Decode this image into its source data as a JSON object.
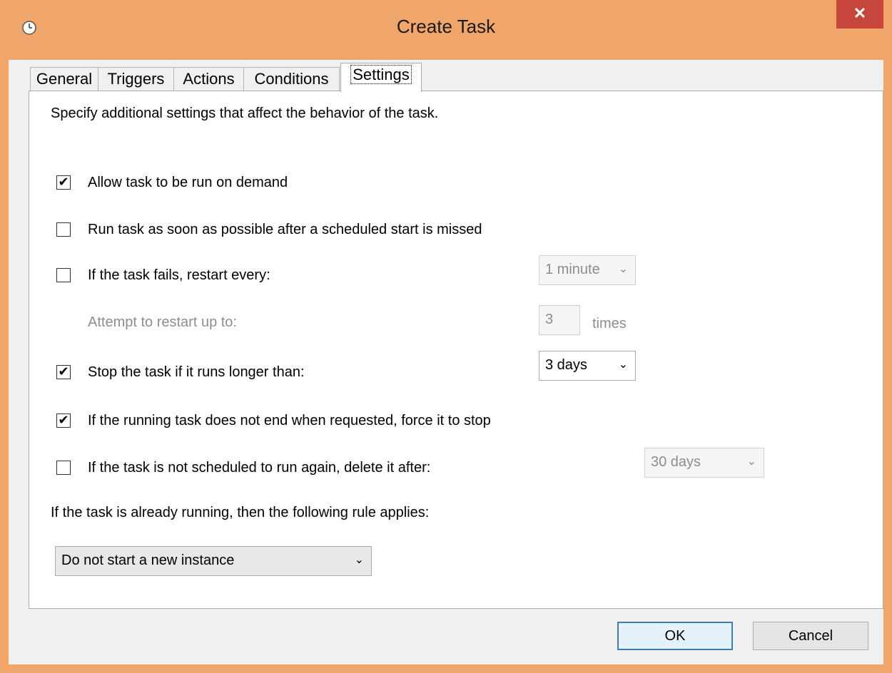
{
  "window": {
    "title": "Create Task",
    "close_glyph": "✕"
  },
  "tabs": [
    {
      "label": "General"
    },
    {
      "label": "Triggers"
    },
    {
      "label": "Actions"
    },
    {
      "label": "Conditions"
    },
    {
      "label": "Settings",
      "active": true
    }
  ],
  "settings": {
    "description": "Specify additional settings that affect the behavior of the task.",
    "allow_on_demand": {
      "label": "Allow task to be run on demand",
      "checked": true
    },
    "run_asap": {
      "label": "Run task as soon as possible after a scheduled start is missed",
      "checked": false
    },
    "restart_every": {
      "label": "If the task fails, restart every:",
      "checked": false,
      "value": "1 minute"
    },
    "attempt_restart": {
      "label": "Attempt to restart up to:",
      "value": "3",
      "suffix": "times"
    },
    "stop_if_longer": {
      "label": "Stop the task if it runs longer than:",
      "checked": true,
      "value": "3 days"
    },
    "force_stop": {
      "label": "If the running task does not end when requested, force it to stop",
      "checked": true
    },
    "delete_after": {
      "label": "If the task is not scheduled to run again, delete it after:",
      "checked": false,
      "value": "30 days"
    },
    "rule_label": "If the task is already running, then the following rule applies:",
    "rule_value": "Do not start a new instance"
  },
  "buttons": {
    "ok": "OK",
    "cancel": "Cancel"
  },
  "glyphs": {
    "check": "✔",
    "chevron": "⌄"
  },
  "colors": {
    "frame": "#f0a66a",
    "close": "#c7463b",
    "default_button_border": "#3c7fb1"
  }
}
